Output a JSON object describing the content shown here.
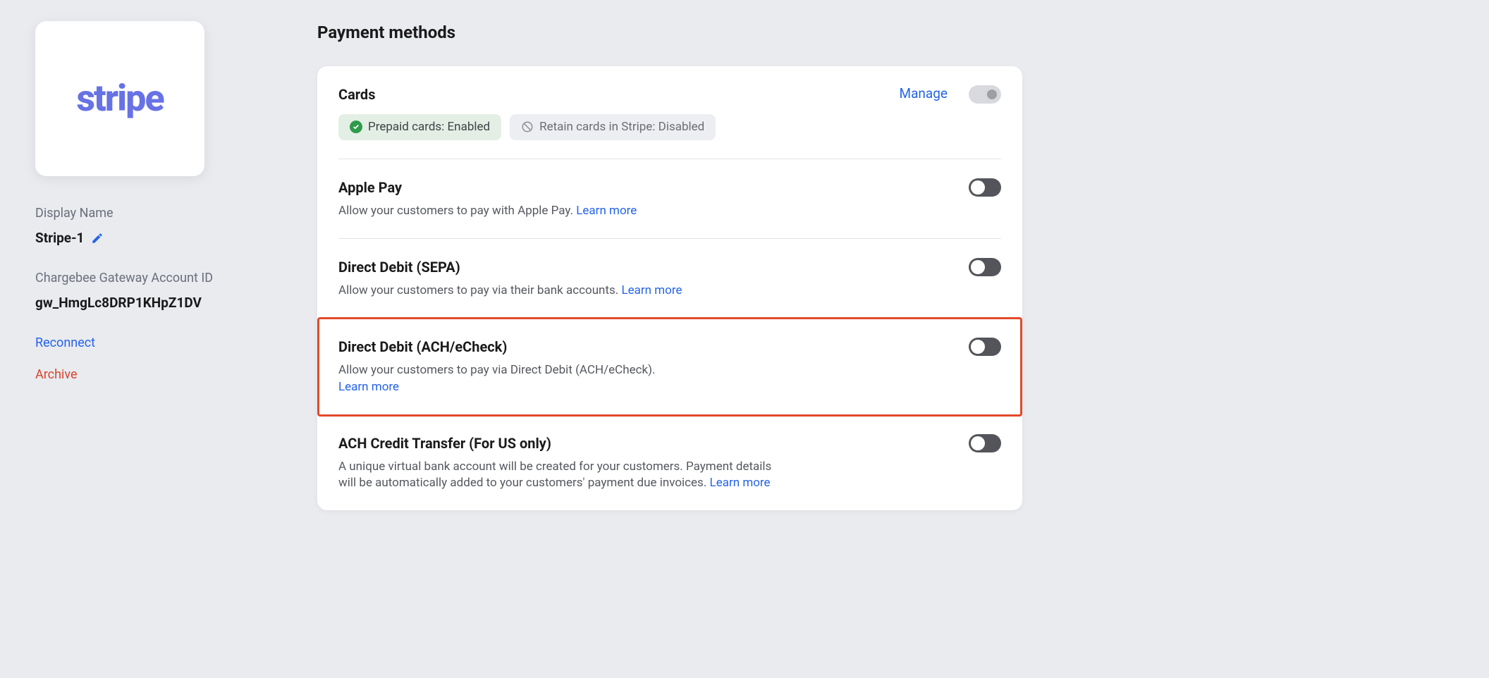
{
  "sidebar": {
    "logo_text": "stripe",
    "display_name_label": "Display Name",
    "display_name_value": "Stripe-1",
    "gateway_id_label": "Chargebee Gateway Account ID",
    "gateway_id_value": "gw_HmgLc8DRP1KHpZ1DV",
    "reconnect_label": "Reconnect",
    "archive_label": "Archive"
  },
  "main": {
    "section_title": "Payment methods",
    "manage_label": "Manage",
    "learn_more_label": "Learn more",
    "methods": {
      "cards": {
        "title": "Cards",
        "badge_prepaid": "Prepaid cards: Enabled",
        "badge_retain": "Retain cards in Stripe: Disabled"
      },
      "apple_pay": {
        "title": "Apple Pay",
        "desc": "Allow your customers to pay with Apple Pay. "
      },
      "sepa": {
        "title": "Direct Debit (SEPA)",
        "desc": "Allow your customers to pay via their bank accounts. "
      },
      "ach": {
        "title": "Direct Debit (ACH/eCheck)",
        "desc": "Allow your customers to pay via Direct Debit (ACH/eCheck)."
      },
      "ach_credit": {
        "title": "ACH Credit Transfer (For US only)",
        "desc": "A unique virtual bank account will be created for your customers. Payment details will be automatically added to your customers' payment due invoices. "
      }
    }
  }
}
